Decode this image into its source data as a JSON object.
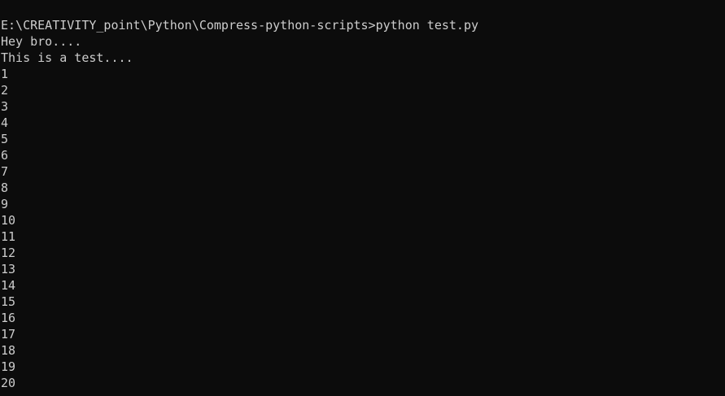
{
  "console": {
    "prompt": "E:\\CREATIVITY_point\\Python\\Compress-python-scripts>",
    "command": "python test.py",
    "output_lines": [
      "Hey bro....",
      "This is a test....",
      "1",
      "2",
      "3",
      "4",
      "5",
      "6",
      "7",
      "8",
      "9",
      "10",
      "11",
      "12",
      "13",
      "14",
      "15",
      "16",
      "17",
      "18",
      "19",
      "20"
    ],
    "colors": {
      "background": "#0c0c0c",
      "text": "#cccccc"
    }
  }
}
